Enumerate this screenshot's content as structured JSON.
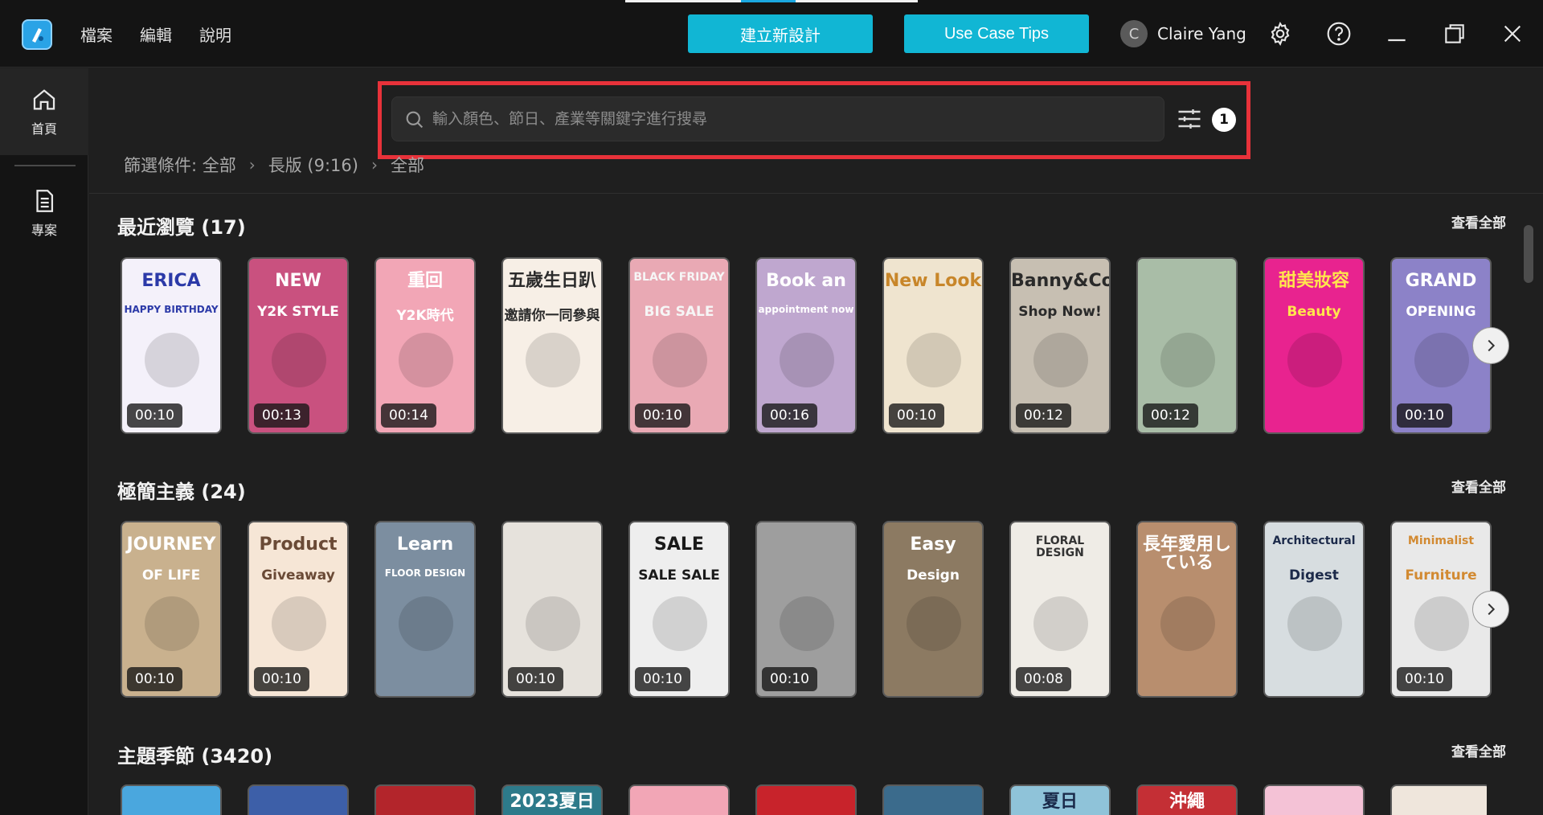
{
  "menu": [
    "檔案",
    "編輯",
    "說明"
  ],
  "header": {
    "create_label": "建立新設計",
    "tips_label": "Use Case Tips"
  },
  "user": {
    "initial": "C",
    "name": "Claire Yang"
  },
  "sidebar": {
    "items": [
      {
        "label": "首頁"
      },
      {
        "label": "專案"
      }
    ]
  },
  "search": {
    "placeholder": "輸入顏色、節日、產業等關鍵字進行搜尋",
    "filter_count": "1"
  },
  "breadcrumb": [
    "篩選條件: 全部",
    "長版 (9:16)",
    "全部"
  ],
  "sections": [
    {
      "title": "最近瀏覽 (17)",
      "view_all": "查看全部",
      "cards": [
        {
          "bg": "#f4f1fa",
          "fg": "#2c3aa8",
          "text": "ERICA",
          "sub": "HAPPY BIRTHDAY",
          "duration": "00:10"
        },
        {
          "bg": "#c9517f",
          "fg": "#ffffff",
          "text": "NEW",
          "sub": "Y2K STYLE",
          "duration": "00:13"
        },
        {
          "bg": "#f2a6b6",
          "fg": "#ffffff",
          "text": "重回",
          "sub": "Y2K時代",
          "duration": "00:14"
        },
        {
          "bg": "#f7efe6",
          "fg": "#2b2b2b",
          "text": "五歲生日趴",
          "sub": "邀請你一同參與",
          "duration": ""
        },
        {
          "bg": "#e9a9b4",
          "fg": "#f6f6f6",
          "text": "BLACK FRIDAY",
          "sub": "BIG SALE",
          "duration": "00:10"
        },
        {
          "bg": "#bfa7cf",
          "fg": "#ffffff",
          "text": "Book an",
          "sub": "appointment now",
          "duration": "00:16"
        },
        {
          "bg": "#efe4cf",
          "fg": "#c8862a",
          "text": "New Look",
          "sub": "",
          "duration": "00:10"
        },
        {
          "bg": "#c7bfb2",
          "fg": "#2a2a2a",
          "text": "Banny&Co",
          "sub": "Shop Now!",
          "duration": "00:12"
        },
        {
          "bg": "#a9bda7",
          "fg": "#ffffff",
          "text": "",
          "sub": "",
          "duration": "00:12"
        },
        {
          "bg": "#e8238f",
          "fg": "#ffe54d",
          "text": "甜美妝容",
          "sub": "Beauty",
          "duration": ""
        },
        {
          "bg": "#8c82c8",
          "fg": "#ffffff",
          "text": "GRAND",
          "sub": "OPENING",
          "duration": "00:10"
        }
      ]
    },
    {
      "title": "極簡主義 (24)",
      "view_all": "查看全部",
      "cards": [
        {
          "bg": "#c9b18e",
          "fg": "#ffffff",
          "text": "JOURNEY",
          "sub": "OF LIFE",
          "duration": "00:10"
        },
        {
          "bg": "#f6e6d6",
          "fg": "#6a4a36",
          "text": "Product",
          "sub": "Giveaway",
          "duration": "00:10"
        },
        {
          "bg": "#7c8ea0",
          "fg": "#ffffff",
          "text": "Learn",
          "sub": "FLOOR DESIGN",
          "duration": ""
        },
        {
          "bg": "#e6e2dc",
          "fg": "#555555",
          "text": "",
          "sub": "",
          "duration": "00:10"
        },
        {
          "bg": "#eeeeee",
          "fg": "#1a1a1a",
          "text": "SALE",
          "sub": "SALE SALE",
          "duration": "00:10"
        },
        {
          "bg": "#9e9e9e",
          "fg": "#ffffff",
          "text": "",
          "sub": "",
          "duration": "00:10"
        },
        {
          "bg": "#8c7a62",
          "fg": "#ffffff",
          "text": "Easy",
          "sub": "Design",
          "duration": ""
        },
        {
          "bg": "#efece6",
          "fg": "#333333",
          "text": "FLORAL DESIGN",
          "sub": "",
          "duration": "00:08"
        },
        {
          "bg": "#b88e6e",
          "fg": "#ffffff",
          "text": "長年愛用している",
          "sub": "",
          "duration": ""
        },
        {
          "bg": "#d7dde0",
          "fg": "#1c2a4a",
          "text": "Architectural",
          "sub": "Digest",
          "duration": ""
        },
        {
          "bg": "#e9e9e9",
          "fg": "#d28a32",
          "text": "Minimalist",
          "sub": "Furniture",
          "duration": "00:10"
        }
      ]
    },
    {
      "title": "主題季節 (3420)",
      "view_all": "查看全部",
      "cards": [
        {
          "bg": "#4aa7de",
          "fg": "#ffffff",
          "text": "",
          "sub": ""
        },
        {
          "bg": "#3d5fa8",
          "fg": "#ffffff",
          "text": "",
          "sub": ""
        },
        {
          "bg": "#b3252b",
          "fg": "#ffd34d",
          "text": "",
          "sub": ""
        },
        {
          "bg": "#2d7a8a",
          "fg": "#ffffff",
          "text": "2023夏日",
          "sub": ""
        },
        {
          "bg": "#f2a6b6",
          "fg": "#ffffff",
          "text": "",
          "sub": ""
        },
        {
          "bg": "#c8232b",
          "fg": "#ffffff",
          "text": "",
          "sub": ""
        },
        {
          "bg": "#3b6b8c",
          "fg": "#ffffff",
          "text": "",
          "sub": ""
        },
        {
          "bg": "#8fc3d9",
          "fg": "#1a2a4a",
          "text": "夏日",
          "sub": ""
        },
        {
          "bg": "#c42f35",
          "fg": "#ffffff",
          "text": "沖繩",
          "sub": ""
        },
        {
          "bg": "#f4c2d6",
          "fg": "#ffffff",
          "text": "",
          "sub": ""
        },
        {
          "bg": "#efe6dc",
          "fg": "#333333",
          "text": "",
          "sub": ""
        }
      ]
    }
  ]
}
